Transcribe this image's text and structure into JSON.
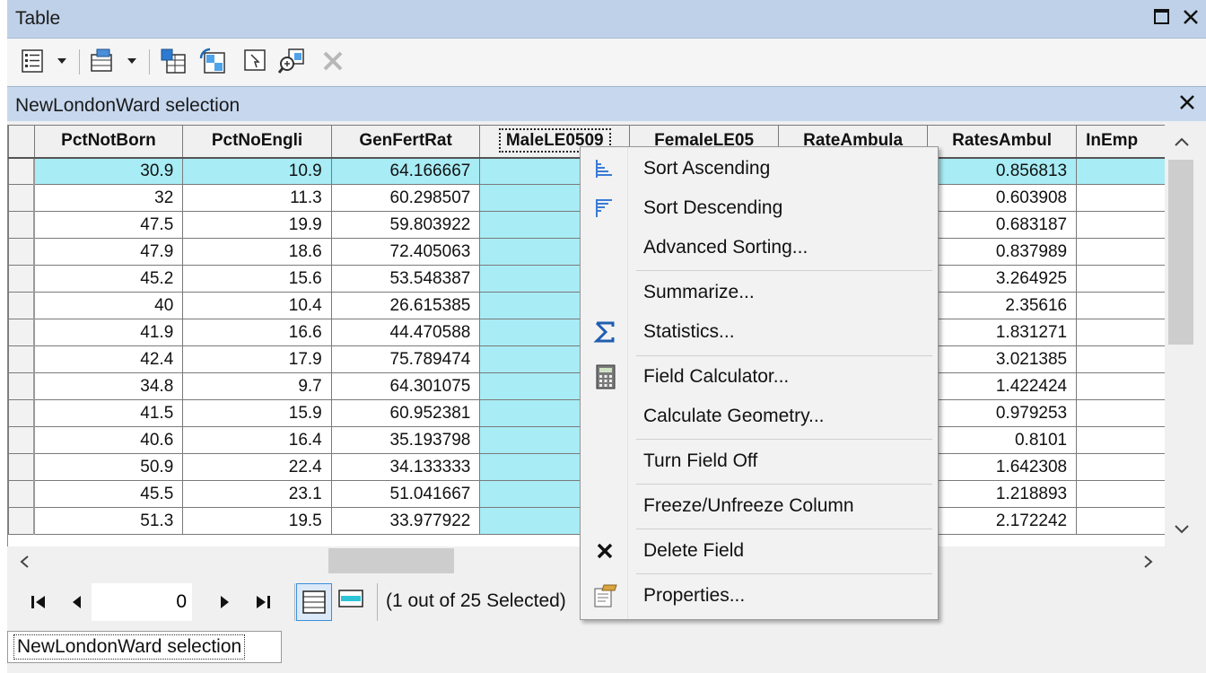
{
  "window": {
    "title": "Table"
  },
  "toolbar": {
    "buttons": [
      "table-options-icon",
      "related-tables-icon",
      "select-by-attributes-icon",
      "switch-selection-icon",
      "clear-selection-icon",
      "zoom-to-selected-icon",
      "delete-selected-icon"
    ]
  },
  "tab": {
    "title": "NewLondonWard selection"
  },
  "grid": {
    "columns": [
      "PctNotBorn",
      "PctNoEngli",
      "GenFertRat",
      "MaleLE0509",
      "FemaleLE05",
      "RateAmbula",
      "RatesAmbul",
      "InEmp"
    ],
    "rows": [
      [
        "30.9",
        "10.9",
        "64.166667",
        "0.856813"
      ],
      [
        "32",
        "11.3",
        "60.298507",
        "0.603908"
      ],
      [
        "47.5",
        "19.9",
        "59.803922",
        "0.683187"
      ],
      [
        "47.9",
        "18.6",
        "72.405063",
        "0.837989"
      ],
      [
        "45.2",
        "15.6",
        "53.548387",
        "3.264925"
      ],
      [
        "40",
        "10.4",
        "26.615385",
        "2.35616"
      ],
      [
        "41.9",
        "16.6",
        "44.470588",
        "1.831271"
      ],
      [
        "42.4",
        "17.9",
        "75.789474",
        "3.021385"
      ],
      [
        "34.8",
        "9.7",
        "64.301075",
        "1.422424"
      ],
      [
        "41.5",
        "15.9",
        "60.952381",
        "0.979253"
      ],
      [
        "40.6",
        "16.4",
        "35.193798",
        "0.8101"
      ],
      [
        "50.9",
        "22.4",
        "34.133333",
        "1.642308"
      ],
      [
        "45.5",
        "23.1",
        "51.041667",
        "1.218893"
      ],
      [
        "51.3",
        "19.5",
        "33.977922",
        "2.172242"
      ]
    ],
    "selected_row_index": 0
  },
  "navigator": {
    "record_value": "0",
    "selection_status": "(1 out of 25 Selected)"
  },
  "bottom_tab": {
    "label": "NewLondonWard selection"
  },
  "context_menu": {
    "items": [
      {
        "label": "Sort Ascending",
        "icon": "sort-ascending-icon"
      },
      {
        "label": "Sort Descending",
        "icon": "sort-descending-icon"
      },
      {
        "label": "Advanced Sorting...",
        "icon": ""
      },
      {
        "label": "Summarize...",
        "icon": ""
      },
      {
        "label": "Statistics...",
        "icon": "sigma-icon"
      },
      {
        "label": "Field Calculator...",
        "icon": "calculator-icon"
      },
      {
        "label": "Calculate Geometry...",
        "icon": ""
      },
      {
        "label": "Turn Field Off",
        "icon": ""
      },
      {
        "label": "Freeze/Unfreeze Column",
        "icon": ""
      },
      {
        "label": "Delete Field",
        "icon": "delete-x-icon"
      },
      {
        "label": "Properties...",
        "icon": "properties-icon"
      }
    ]
  }
}
